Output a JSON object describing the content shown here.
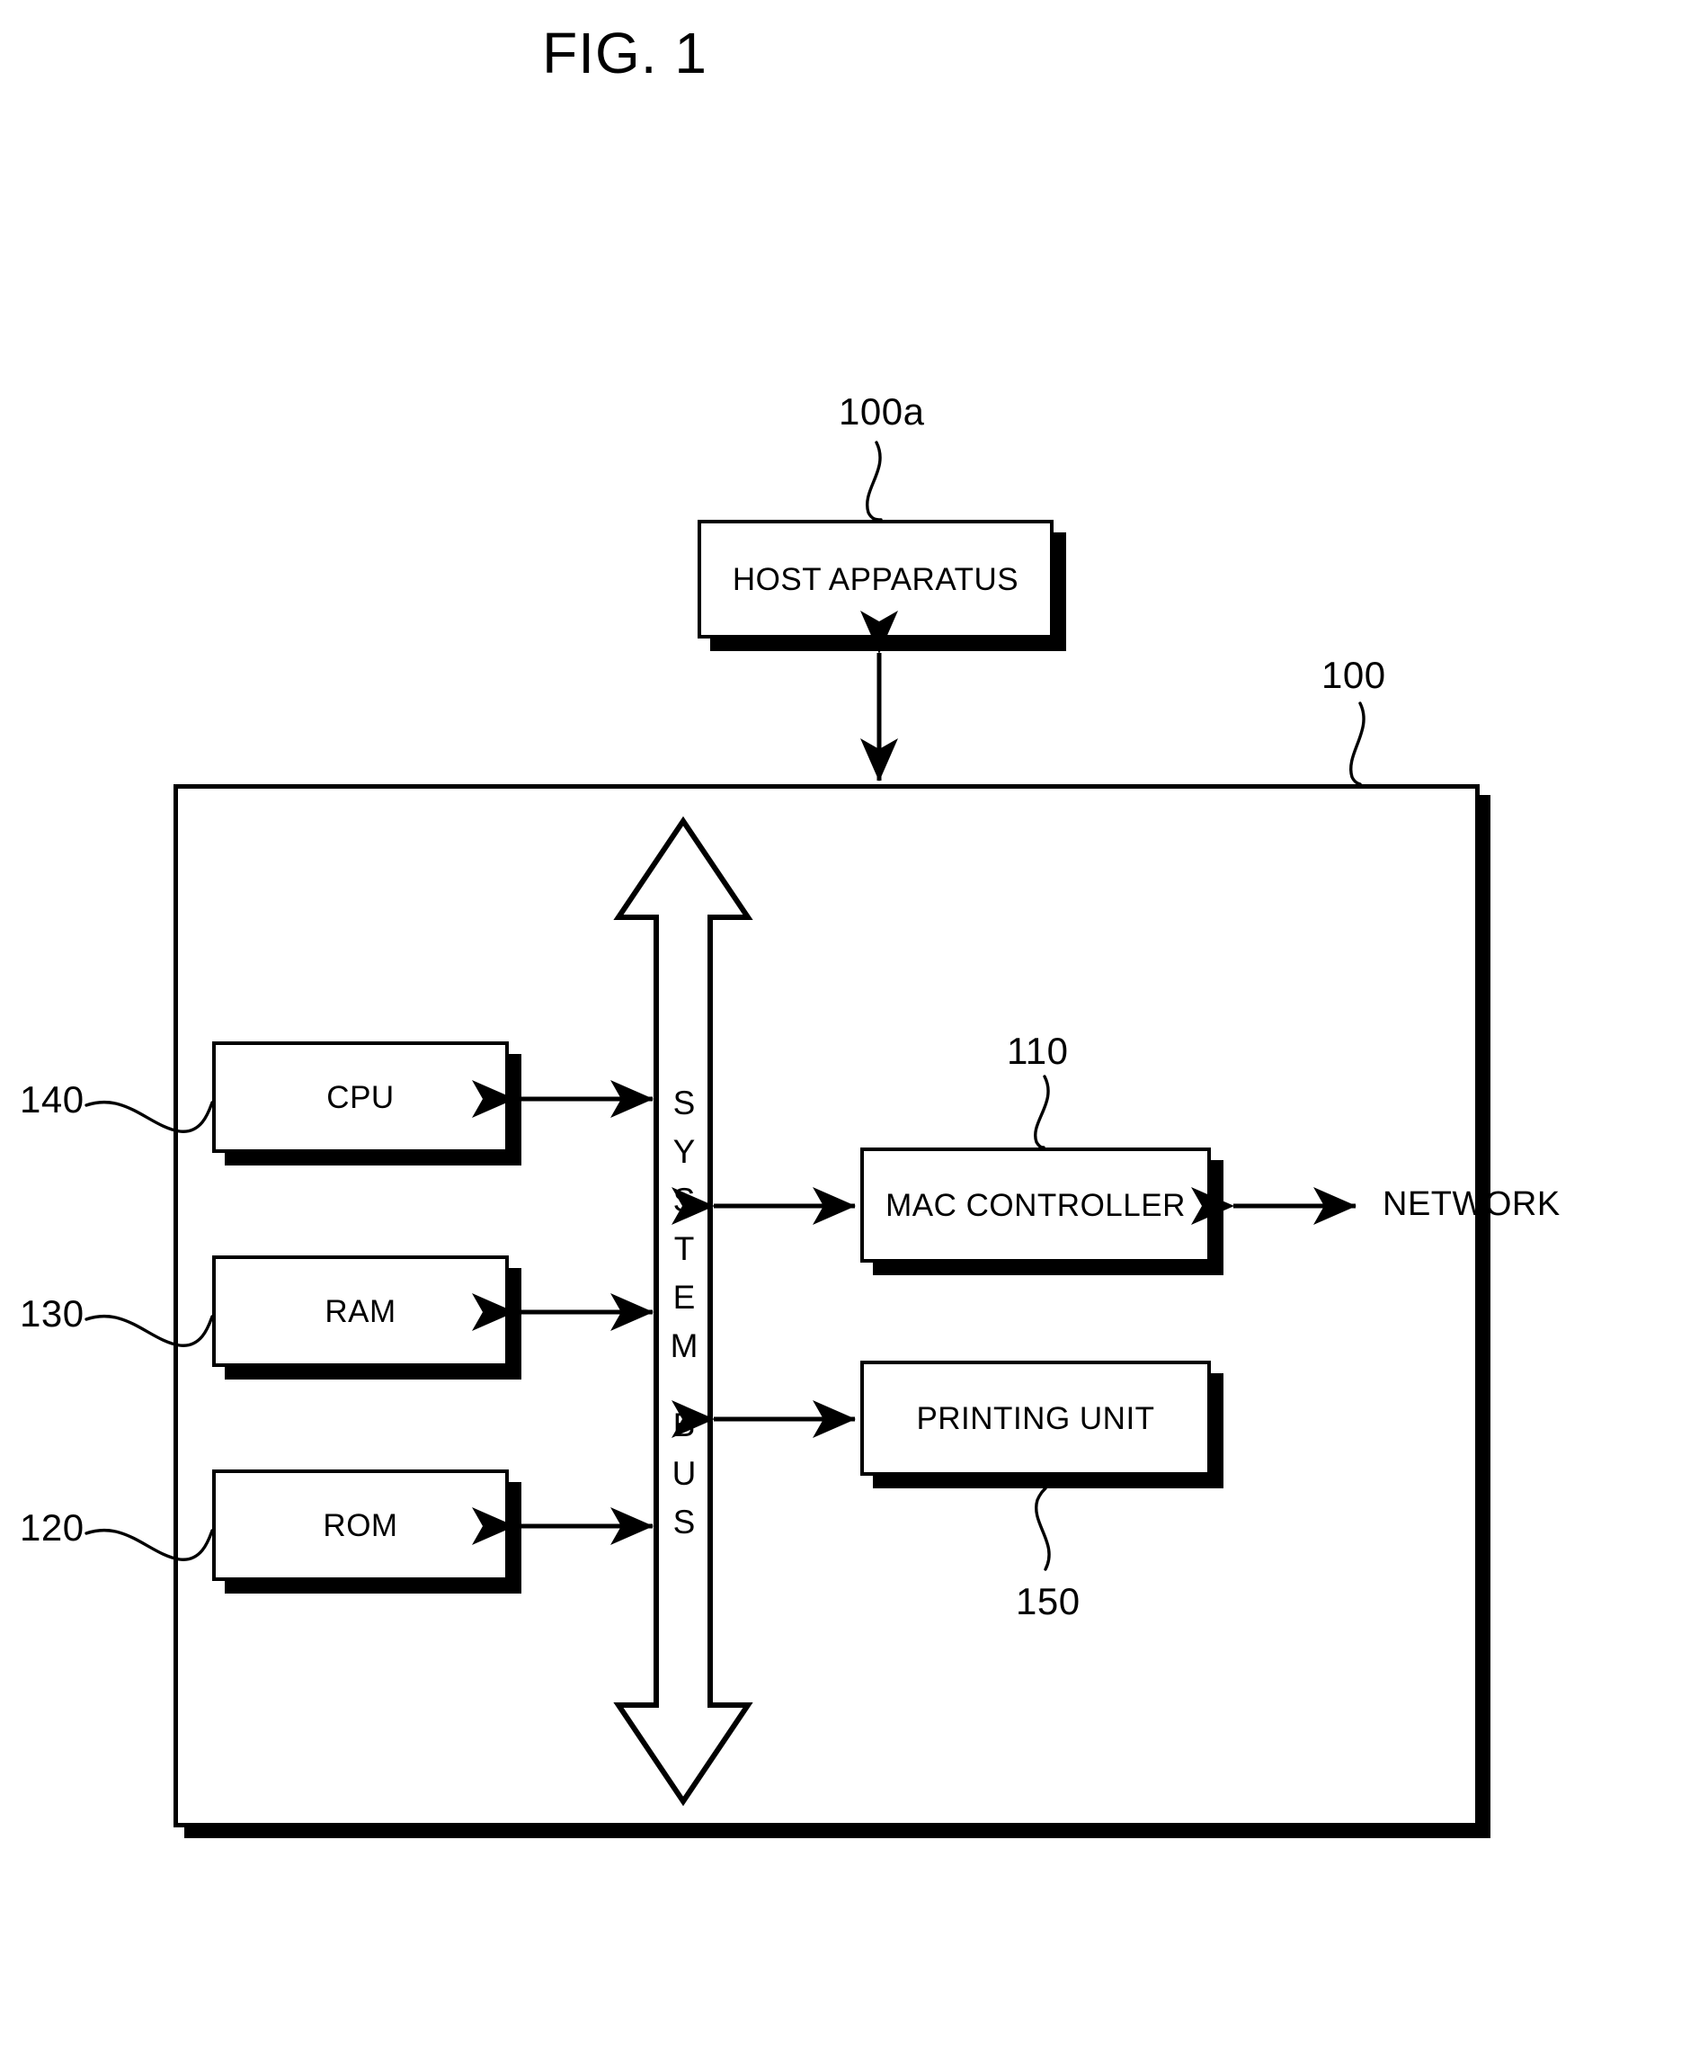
{
  "figure": {
    "title": "FIG. 1"
  },
  "nodes": {
    "host_apparatus": {
      "label": "HOST APPARATUS",
      "ref": "100a"
    },
    "printer": {
      "ref": "100"
    },
    "cpu": {
      "label": "CPU",
      "ref": "140"
    },
    "ram": {
      "label": "RAM",
      "ref": "130"
    },
    "rom": {
      "label": "ROM",
      "ref": "120"
    },
    "mac_controller": {
      "label": "MAC CONTROLLER",
      "ref": "110"
    },
    "printing_unit": {
      "label": "PRINTING UNIT",
      "ref": "150"
    },
    "network": {
      "label": "NETWORK"
    }
  },
  "system_bus": {
    "letters": [
      "S",
      "Y",
      "S",
      "T",
      "E",
      "M",
      "",
      "B",
      "U",
      "S"
    ]
  },
  "colors": {
    "ink": "#000000",
    "paper": "#ffffff"
  }
}
